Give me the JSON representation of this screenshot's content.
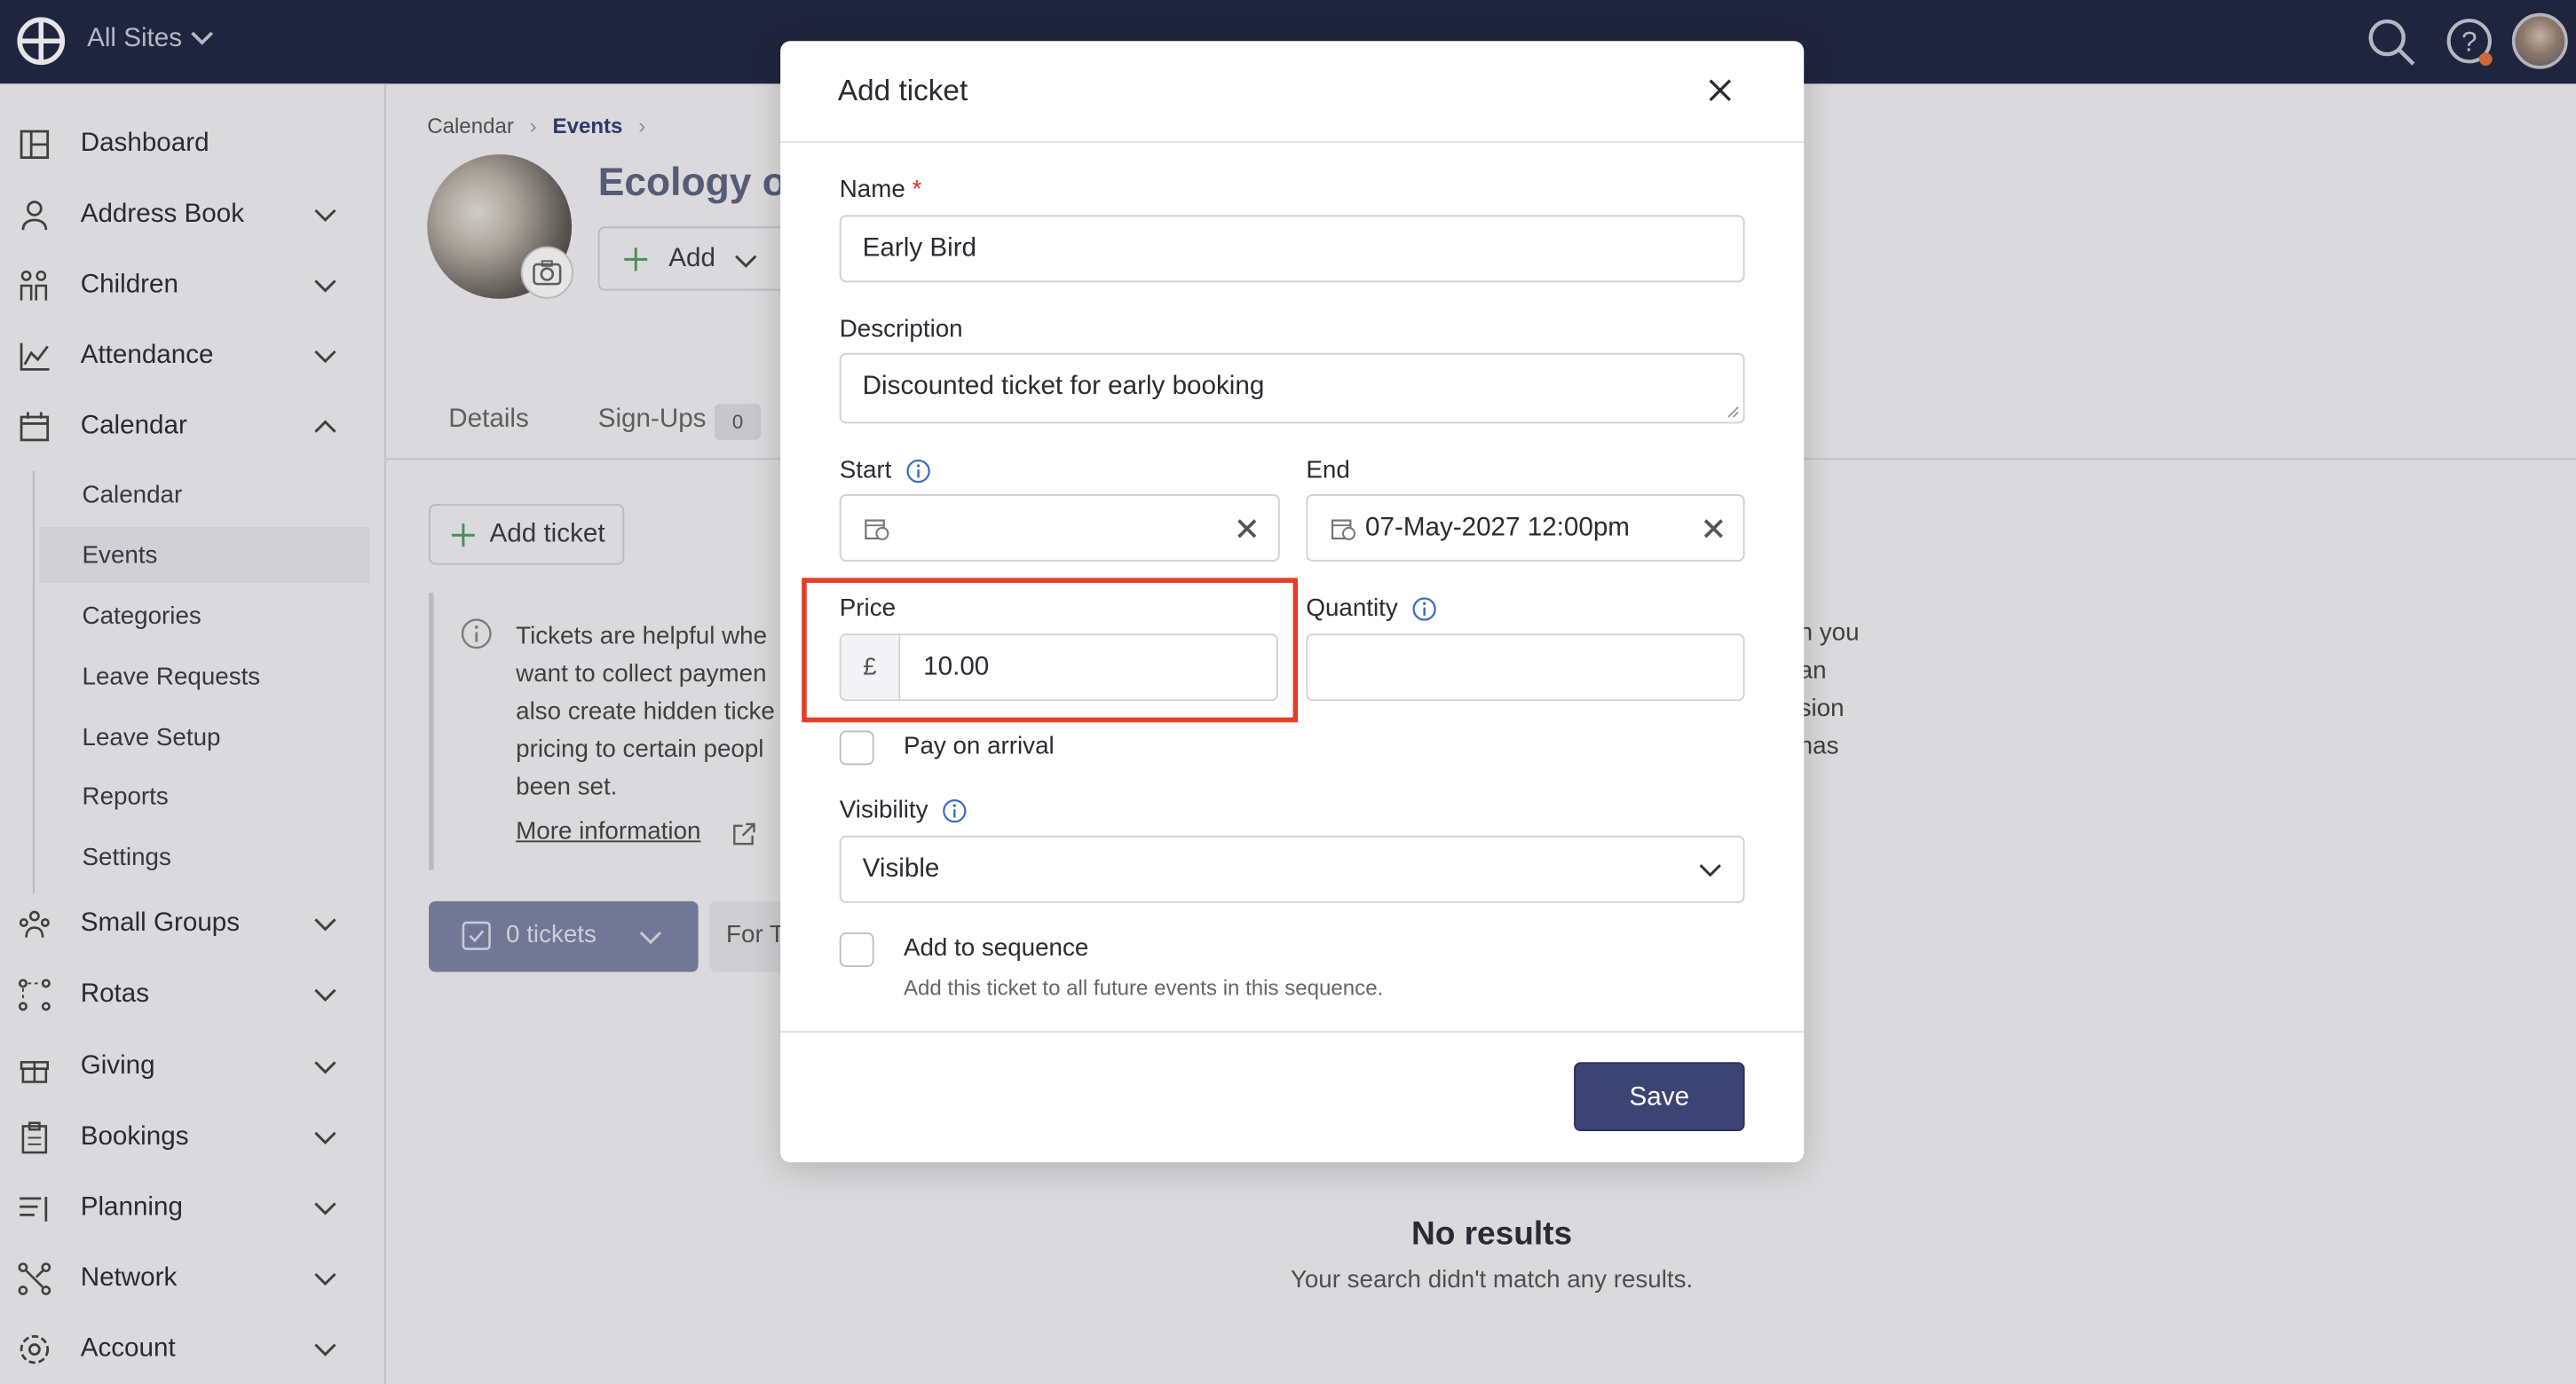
{
  "topbar": {
    "sites_label": "All Sites"
  },
  "sidebar": {
    "items": [
      {
        "label": "Dashboard",
        "icon": "dashboard-icon"
      },
      {
        "label": "Address Book",
        "icon": "person-icon"
      },
      {
        "label": "Children",
        "icon": "children-icon"
      },
      {
        "label": "Attendance",
        "icon": "chart-icon"
      },
      {
        "label": "Calendar",
        "icon": "calendar-icon"
      },
      {
        "label": "Small Groups",
        "icon": "groups-icon"
      },
      {
        "label": "Rotas",
        "icon": "rotas-icon"
      },
      {
        "label": "Giving",
        "icon": "gift-icon"
      },
      {
        "label": "Bookings",
        "icon": "clipboard-icon"
      },
      {
        "label": "Planning",
        "icon": "planning-icon"
      },
      {
        "label": "Network",
        "icon": "network-icon"
      },
      {
        "label": "Account",
        "icon": "gear-icon"
      }
    ],
    "calendar_sub": [
      "Calendar",
      "Events",
      "Categories",
      "Leave Requests",
      "Leave Setup",
      "Reports",
      "Settings"
    ],
    "active_sub": "Events"
  },
  "main": {
    "breadcrumb": {
      "parent": "Calendar",
      "current": "Events"
    },
    "event_title": "Ecology or",
    "add_label": "Add",
    "tabs": {
      "details": "Details",
      "signups": "Sign-Ups",
      "signups_count": "0"
    },
    "add_ticket_label": "Add ticket",
    "info_text": "Tickets are helpful whe\nwant to collect paymen\nalso create hidden ticke\npricing to certain peopl\nbeen set.",
    "info_right_text": "n you\nan\nsion\nhas",
    "more_info": "More information",
    "tickets_button": "0 tickets",
    "for_button": "For T",
    "no_results_title": "No results",
    "no_results_sub": "Your search didn't match any results."
  },
  "modal": {
    "title": "Add ticket",
    "name_label": "Name",
    "required_mark": "*",
    "name_value": "Early Bird",
    "description_label": "Description",
    "description_value": "Discounted ticket for early booking",
    "start_label": "Start",
    "start_value": "",
    "end_label": "End",
    "end_value": "07-May-2027 12:00pm",
    "price_label": "Price",
    "currency": "£",
    "price_value": "10.00",
    "quantity_label": "Quantity",
    "quantity_value": "",
    "pay_on_arrival": "Pay on arrival",
    "visibility_label": "Visibility",
    "visibility_value": "Visible",
    "add_to_sequence": "Add to sequence",
    "sequence_hint": "Add this ticket to all future events in this sequence.",
    "save_label": "Save"
  },
  "colors": {
    "topbar": "#1f2540",
    "primary": "#3c4474",
    "highlight": "#e33d27",
    "required": "#d9351f"
  }
}
